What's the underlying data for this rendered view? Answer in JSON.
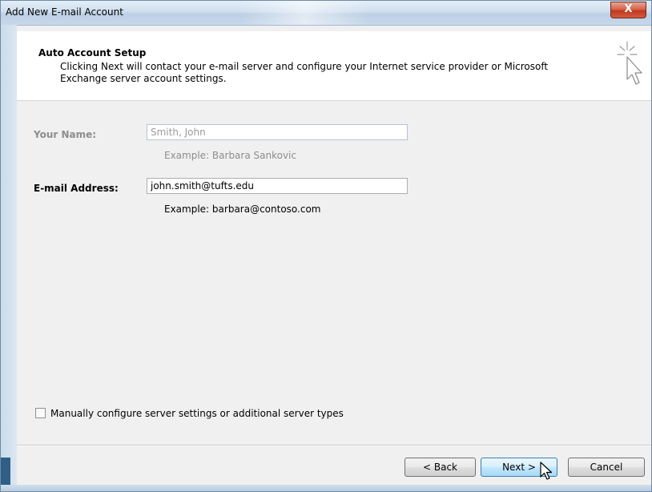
{
  "window": {
    "title": "Add New E-mail Account",
    "close_label": "X"
  },
  "header": {
    "heading": "Auto Account Setup",
    "description": "Clicking Next will contact your e-mail server and configure your Internet service provider or Microsoft Exchange server account settings.",
    "icon": "cursor-sparkle-icon"
  },
  "form": {
    "name": {
      "label": "Your Name:",
      "value": "Smith, John",
      "example": "Example: Barbara Sankovic",
      "enabled": false
    },
    "email": {
      "label": "E-mail Address:",
      "value": "john.smith@tufts.edu",
      "example": "Example: barbara@contoso.com",
      "enabled": true
    },
    "manual_config": {
      "label": "Manually configure server settings or additional server types",
      "checked": false
    }
  },
  "buttons": {
    "back": "< Back",
    "next": "Next >",
    "cancel": "Cancel"
  },
  "colors": {
    "accent": "#3c7fb1",
    "close": "#c0391f",
    "disabled_text": "#8d8d8d"
  }
}
